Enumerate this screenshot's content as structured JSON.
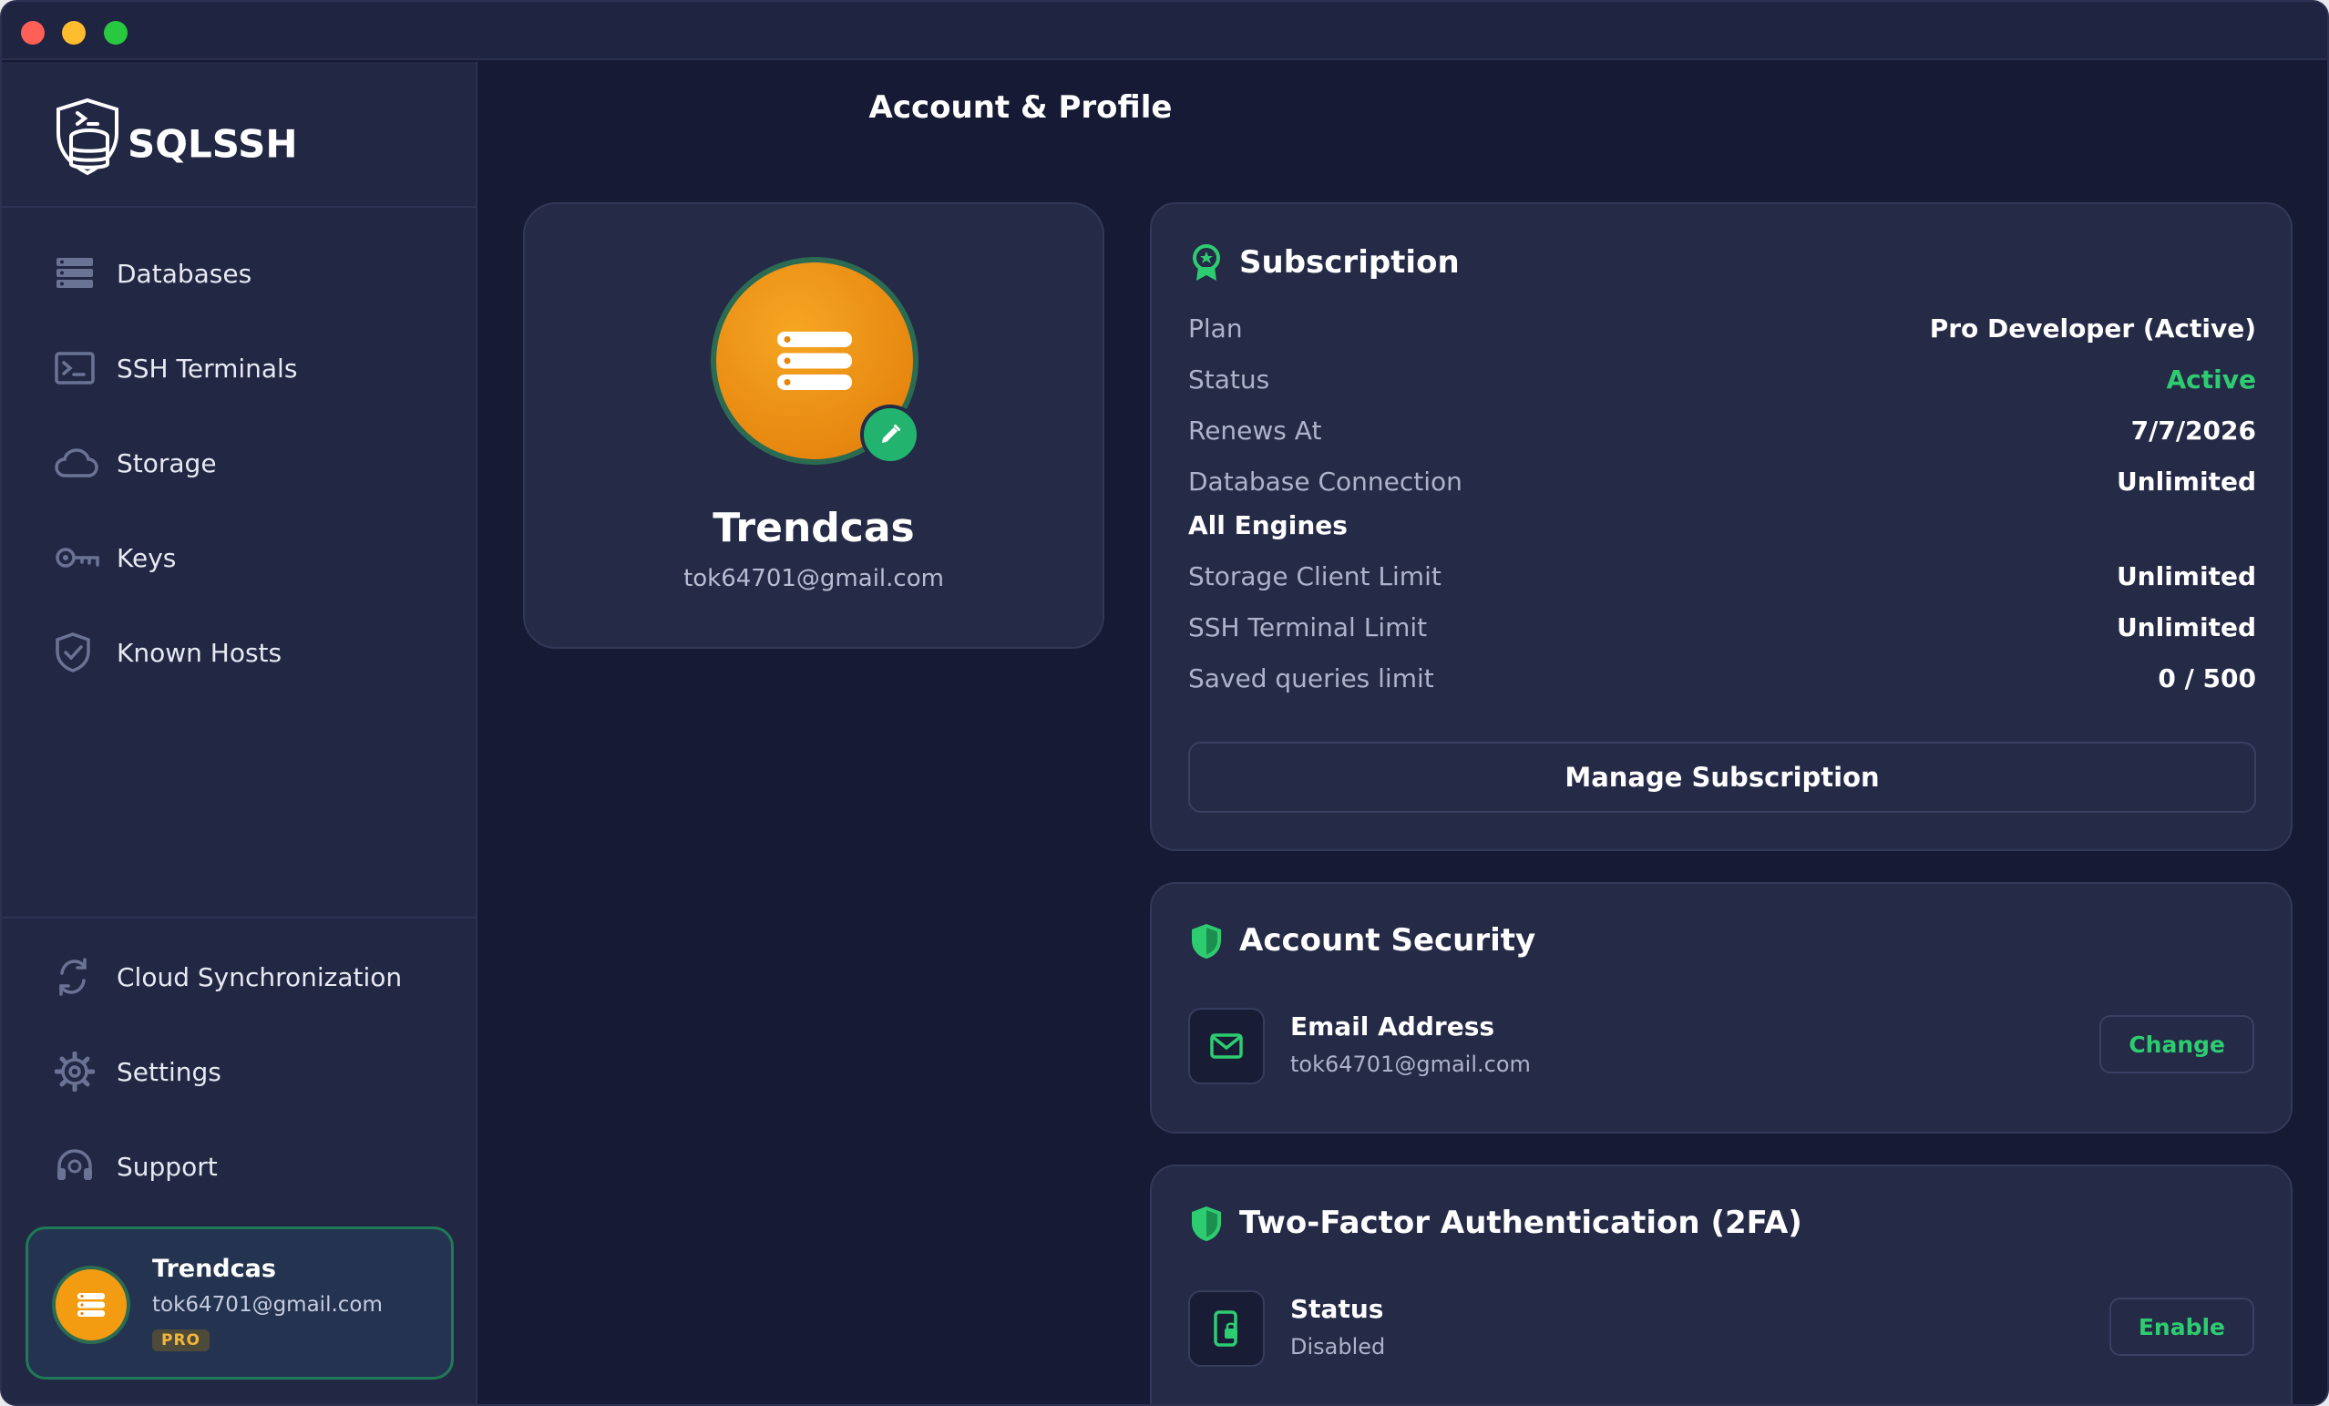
{
  "app": {
    "name": "SQLSSH"
  },
  "page": {
    "title": "Account & Profile"
  },
  "sidebar": {
    "items": [
      {
        "label": "Databases",
        "icon": "database-icon"
      },
      {
        "label": "SSH Terminals",
        "icon": "terminal-icon"
      },
      {
        "label": "Storage",
        "icon": "cloud-icon"
      },
      {
        "label": "Keys",
        "icon": "key-icon"
      },
      {
        "label": "Known Hosts",
        "icon": "shield-check-icon"
      }
    ],
    "bottom_items": [
      {
        "label": "Cloud Synchronization",
        "icon": "sync-icon"
      },
      {
        "label": "Settings",
        "icon": "gear-icon"
      },
      {
        "label": "Support",
        "icon": "headset-icon"
      }
    ],
    "user": {
      "name": "Trendcas",
      "email": "tok64701@gmail.com",
      "badge": "PRO"
    }
  },
  "profile": {
    "name": "Trendcas",
    "email": "tok64701@gmail.com"
  },
  "subscription": {
    "title": "Subscription",
    "rows": [
      {
        "key": "Plan",
        "value": "Pro Developer (Active)"
      },
      {
        "key": "Status",
        "value": "Active"
      },
      {
        "key": "Renews At",
        "value": "7/7/2026"
      },
      {
        "key": "Database Connection",
        "value": "Unlimited"
      },
      {
        "key": "Storage Client Limit",
        "value": "Unlimited"
      },
      {
        "key": "SSH Terminal Limit",
        "value": "Unlimited"
      },
      {
        "key": "Saved queries limit",
        "value": "0 / 500"
      }
    ],
    "engines_label": "All Engines",
    "manage_label": "Manage Subscription"
  },
  "security": {
    "title": "Account Security",
    "email_label": "Email Address",
    "email_value": "tok64701@gmail.com",
    "change_label": "Change"
  },
  "twofa": {
    "title": "Two-Factor Authentication (2FA)",
    "status_label": "Status",
    "status_value": "Disabled",
    "enable_label": "Enable"
  },
  "colors": {
    "accent_green": "#2ecc71",
    "avatar_orange": "#f39c12",
    "background": "#161a34",
    "panel": "#252a47"
  }
}
